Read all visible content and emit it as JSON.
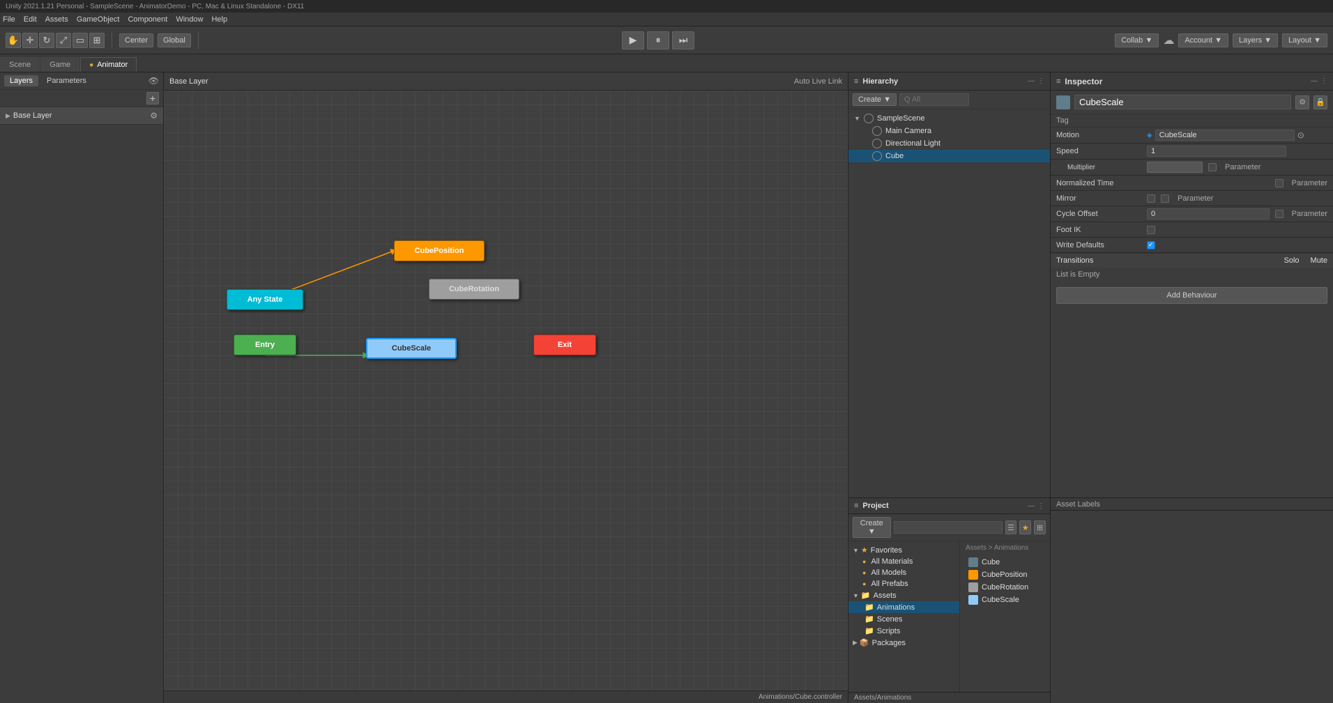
{
  "menubar": {
    "items": [
      "File",
      "Edit",
      "Assets",
      "GameObject",
      "Component",
      "Window",
      "Help"
    ],
    "title": "Unity 2021.1.21 Personal - SampleScene - AnimatorDemo - PC, Mac & Linux Standalone - DX11"
  },
  "toolbar": {
    "tools": [
      "hand",
      "move",
      "rotate",
      "scale",
      "rect",
      "transform"
    ],
    "center_label": "Center",
    "global_label": "Global",
    "collab_label": "Collab ▼",
    "account_label": "Account ▼",
    "layers_label": "Layers ▼",
    "layout_label": "Layout ▼",
    "cloud_icon": "☁"
  },
  "tabs": {
    "scene_label": "Scene",
    "game_label": "Game",
    "animator_label": "Animator",
    "animator_active": true
  },
  "left_panel": {
    "layers_tab": "Layers",
    "params_tab": "Parameters",
    "add_label": "+",
    "base_layer_name": "Base Layer"
  },
  "animator": {
    "breadcrumb": "Base Layer",
    "auto_live_link": "Auto Live Link",
    "path": "Animations/Cube.controller",
    "nodes": {
      "entry": "Entry",
      "exit": "Exit",
      "any_state": "Any State",
      "cube_position": "CubePosition",
      "cube_rotation": "CubeRotation",
      "cube_scale": "CubeScale"
    }
  },
  "hierarchy": {
    "title": "Hierarchy",
    "create_label": "Create ▼",
    "search_placeholder": "Q All",
    "scene_name": "SampleScene",
    "items": [
      {
        "label": "Main Camera",
        "indent": 1
      },
      {
        "label": "Directional Light",
        "indent": 1
      },
      {
        "label": "Cube",
        "indent": 1,
        "selected": true
      }
    ]
  },
  "inspector": {
    "title": "Inspector",
    "object_name": "CubeScale",
    "tag_label": "Tag",
    "tag_value": "",
    "fields": {
      "motion_label": "Motion",
      "motion_value": "CubeScale",
      "speed_label": "Speed",
      "speed_value": "1",
      "multiplier_label": "Multiplier",
      "normalized_time_label": "Normalized Time",
      "mirror_label": "Mirror",
      "cycle_offset_label": "Cycle Offset",
      "cycle_offset_value": "0",
      "foot_ik_label": "Foot IK",
      "write_defaults_label": "Write Defaults",
      "param_label": "Parameter"
    },
    "transitions": {
      "title": "Transitions",
      "solo_label": "Solo",
      "mute_label": "Mute",
      "list_empty": "List is Empty"
    },
    "add_behaviour_label": "Add Behaviour",
    "asset_labels": "Asset Labels"
  },
  "project": {
    "title": "Project",
    "create_label": "Create ▼",
    "search_placeholder": "",
    "favorites": {
      "label": "Favorites",
      "items": [
        "All Materials",
        "All Models",
        "All Prefabs"
      ]
    },
    "assets": {
      "label": "Assets",
      "animations_label": "Animations",
      "breadcrumb": "Assets > Animations",
      "items": [
        "Cube",
        "CubePosition",
        "CubeRotation",
        "CubeScale"
      ],
      "folders": [
        "Animations",
        "Scenes",
        "Scripts"
      ]
    },
    "packages_label": "Packages",
    "bottom_path": "Assets/Animations"
  }
}
